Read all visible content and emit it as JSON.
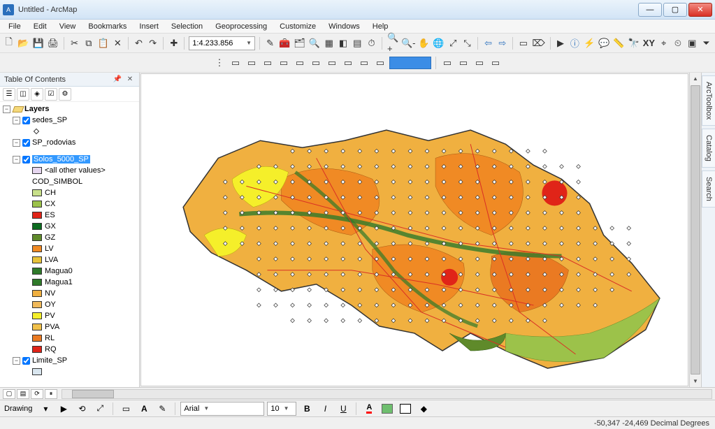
{
  "window": {
    "title": "Untitled - ArcMap",
    "app_icon_letter": "A"
  },
  "menu": [
    "File",
    "Edit",
    "View",
    "Bookmarks",
    "Insert",
    "Selection",
    "Geoprocessing",
    "Customize",
    "Windows",
    "Help"
  ],
  "toolbar1": {
    "scale": "1:4.233.856"
  },
  "toc": {
    "title": "Table Of Contents",
    "root": "Layers",
    "layers": [
      {
        "name": "sedes_SP",
        "checked": true,
        "symbol_type": "point"
      },
      {
        "name": "SP_rodovias",
        "checked": true,
        "symbol_type": "none"
      },
      {
        "name": "Solos_5000_SP",
        "checked": true,
        "selected": true,
        "all_other_values": "<all other values>",
        "field": "COD_SIMBOL",
        "classes": [
          {
            "code": "CH",
            "color": "#c8e08a"
          },
          {
            "code": "CX",
            "color": "#9cc24a"
          },
          {
            "code": "ES",
            "color": "#e02418"
          },
          {
            "code": "GX",
            "color": "#0b6b1f"
          },
          {
            "code": "GZ",
            "color": "#5f8a2a"
          },
          {
            "code": "LV",
            "color": "#f08a24"
          },
          {
            "code": "LVA",
            "color": "#e8c33a"
          },
          {
            "code": "Magua0",
            "color": "#2f7a2a"
          },
          {
            "code": "Magua1",
            "color": "#2f7a2a"
          },
          {
            "code": "NV",
            "color": "#f0b040"
          },
          {
            "code": "OY",
            "color": "#f0b95a"
          },
          {
            "code": "PV",
            "color": "#f5ef2a"
          },
          {
            "code": "PVA",
            "color": "#f0c04a"
          },
          {
            "code": "RL",
            "color": "#ea7a22"
          },
          {
            "code": "RQ",
            "color": "#e02418"
          }
        ]
      },
      {
        "name": "Limite_SP",
        "checked": true,
        "symbol_type": "box",
        "symbol_color": "#d9e6ef"
      }
    ]
  },
  "right_tabs": [
    "ArcToolbox",
    "Catalog",
    "Search"
  ],
  "drawbar": {
    "label": "Drawing",
    "font": "Arial",
    "size": "10"
  },
  "status": {
    "coords": "-50,347  -24,469 Decimal Degrees"
  }
}
